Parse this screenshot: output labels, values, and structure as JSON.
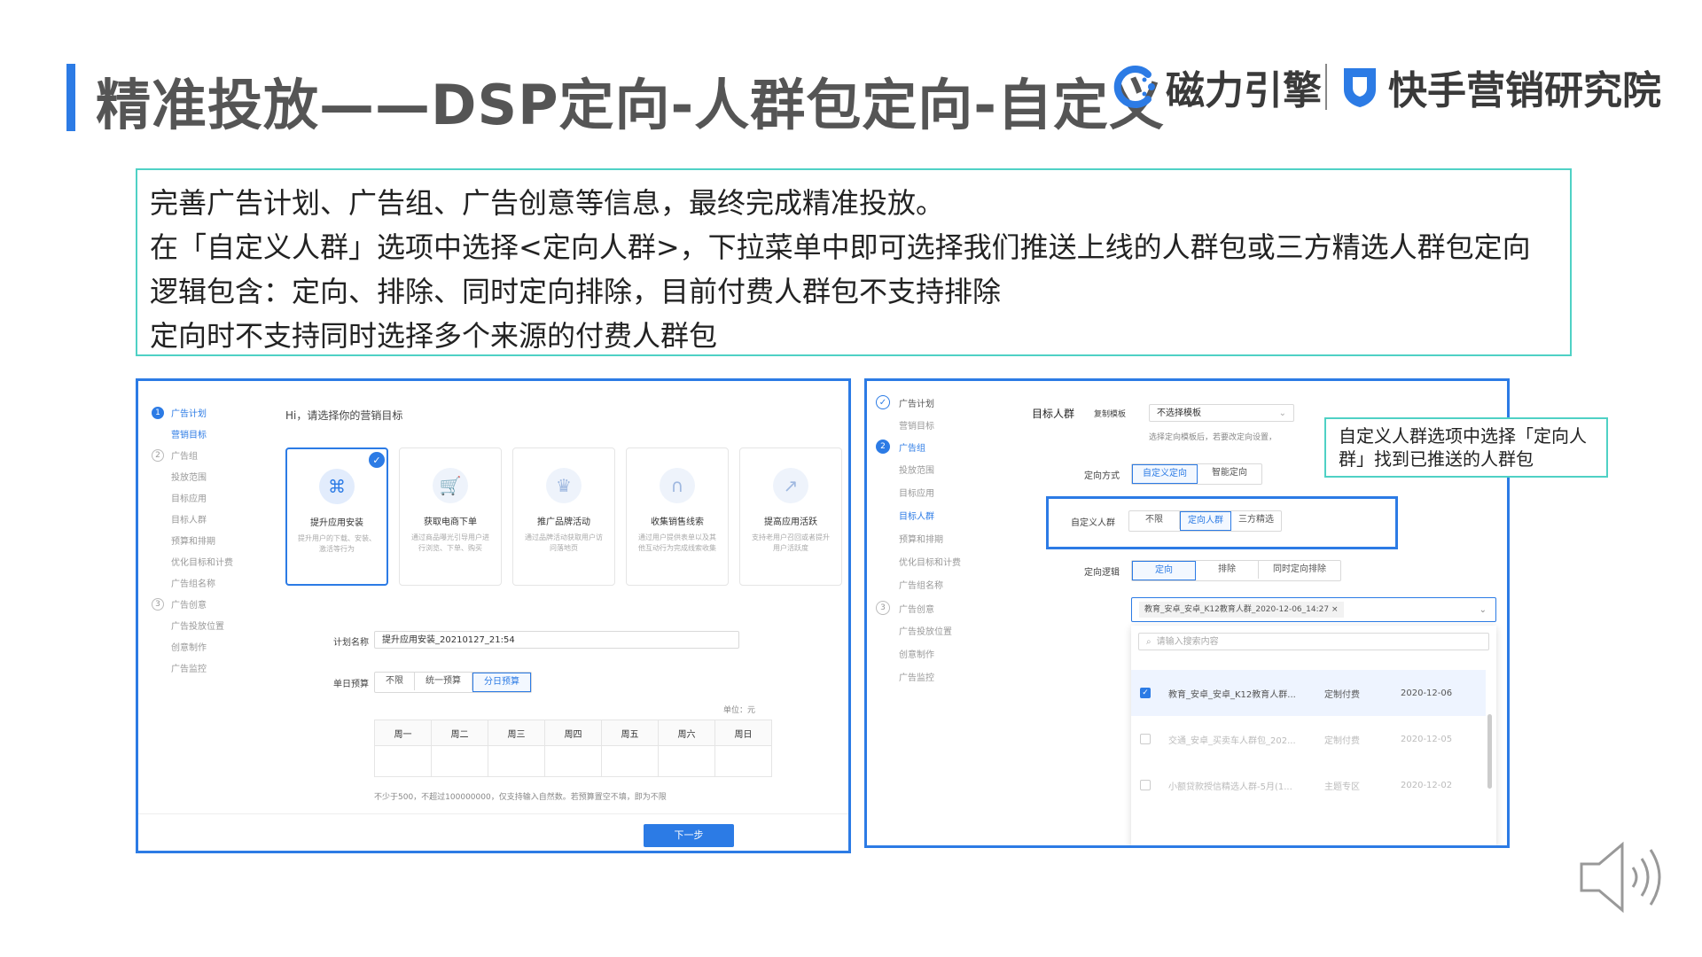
{
  "header": {
    "title": "精准投放——DSP定向-人群包定向-自定义",
    "brand1": "磁力引擎",
    "brand2": "快手营销研究院"
  },
  "description": {
    "lines": [
      "完善广告计划、广告组、广告创意等信息，最终完成精准投放。",
      "在「自定义人群」选项中选择<定向人群>，下拉菜单中即可选择我们推送上线的人群包或三方精选人群包定向",
      "逻辑包含：定向、排除、同时定向排除，目前付费人群包不支持排除",
      "定向时不支持同时选择多个来源的付费人群包"
    ]
  },
  "left_panel": {
    "steps": [
      {
        "num": "1",
        "label": "广告计划"
      },
      {
        "num": "2",
        "label": "广告组"
      },
      {
        "num": "3",
        "label": "广告创意"
      }
    ],
    "nav_step1_sub": [
      "营销目标"
    ],
    "nav_step2_sub": [
      "投放范围",
      "目标应用",
      "目标人群",
      "预算和排期",
      "优化目标和计费",
      "广告组名称"
    ],
    "nav_step3_sub": [
      "广告投放位置",
      "创意制作",
      "广告监控"
    ],
    "greeting": "Hi，请选择你的营销目标",
    "cards": [
      {
        "title": "提升应用安装",
        "desc": "提升用户的下载、安装、激活等行为",
        "icon": "apps-icon"
      },
      {
        "title": "获取电商下单",
        "desc": "通过商品曝光引导用户进行浏览、下单、购买",
        "icon": "cart-icon"
      },
      {
        "title": "推广品牌活动",
        "desc": "通过品牌活动获取用户访问落地页",
        "icon": "crown-icon"
      },
      {
        "title": "收集销售线索",
        "desc": "通过用户提供表单以及其他互动行为完成线索收集",
        "icon": "magnet-icon"
      },
      {
        "title": "提高应用活跃",
        "desc": "支持老用户召回或者提升用户活跃度",
        "icon": "chart-icon"
      }
    ],
    "plan_name_label": "计划名称",
    "plan_name_value": "提升应用安装_20210127_21:54",
    "budget_label": "单日预算",
    "budget_options": [
      "不限",
      "统一预算",
      "分日预算"
    ],
    "unit": "单位：元",
    "weekdays": [
      "周一",
      "周二",
      "周三",
      "周四",
      "周五",
      "周六",
      "周日"
    ],
    "hint": "不少于500，不超过100000000，仅支持输入自然数。若预算置空不填，即为不限",
    "next_button": "下一步"
  },
  "right_panel": {
    "steps": [
      {
        "num": "✓",
        "label": "广告计划"
      },
      {
        "num": "2",
        "label": "广告组"
      },
      {
        "num": "3",
        "label": "广告创意"
      }
    ],
    "nav_step1_sub": [
      "营销目标"
    ],
    "nav_step2_sub": [
      "投放范围",
      "目标应用",
      "目标人群",
      "预算和排期",
      "优化目标和计费",
      "广告组名称"
    ],
    "nav_step3_sub": [
      "广告投放位置",
      "创意制作",
      "广告监控"
    ],
    "target_label": "目标人群",
    "copy_template_label": "复制模板",
    "template_select": "不选择模板",
    "template_hint": "选择定向模板后，若要改定向设置，",
    "mode_label": "定向方式",
    "mode_options": [
      "自定义定向",
      "智能定向"
    ],
    "custom_label": "自定义人群",
    "custom_options": [
      "不限",
      "定向人群",
      "三方精选"
    ],
    "logic_label": "定向逻辑",
    "logic_options": [
      "定向",
      "排除",
      "同时定向排除"
    ],
    "selected_tag": "教育_安卓_安卓_K12教育人群_2020-12-06_14:27",
    "search_placeholder": "请输入搜索内容",
    "rows": [
      {
        "name": "教育_安卓_安卓_K12教育人群...",
        "type": "定制付费",
        "date": "2020-12-06",
        "checked": true
      },
      {
        "name": "交通_安卓_买卖车人群包_202...",
        "type": "定制付费",
        "date": "2020-12-05",
        "checked": false
      },
      {
        "name": "小额贷款授信精选人群-5月(1...",
        "type": "主题专区",
        "date": "2020-12-02",
        "checked": false
      }
    ]
  },
  "callout": {
    "text": "自定义人群选项中选择「定向人群」找到已推送的人群包"
  },
  "colors": {
    "accent": "#2c7be5",
    "teal_border": "#4fd1c5",
    "title_gray": "#555555"
  }
}
